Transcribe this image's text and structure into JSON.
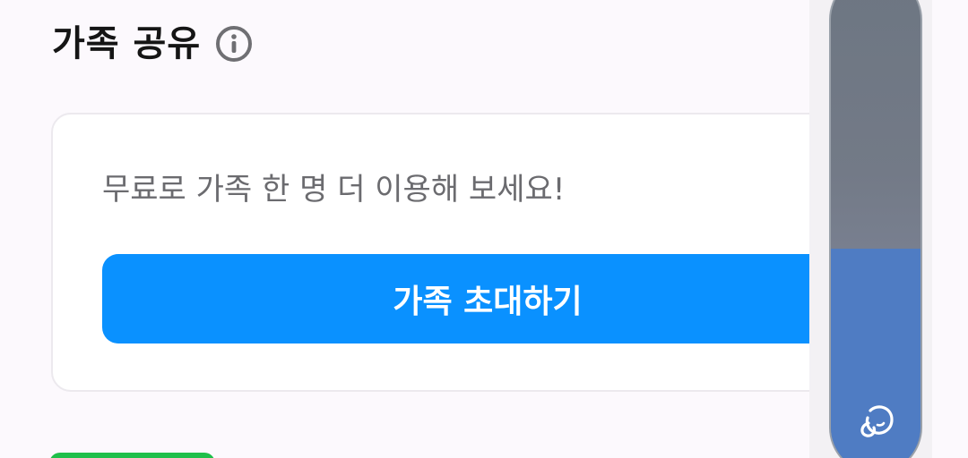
{
  "section": {
    "title": "가족 공유",
    "info_icon": "info-circle-icon"
  },
  "card": {
    "message": "무료로 가족 한 명 더 이용해 보세요!",
    "invite_button_label": "가족 초대하기"
  },
  "edge_handle": {
    "fill_fraction": 0.45,
    "icon": "assistant-bubble-icon"
  },
  "colors": {
    "accent": "#0a91ff",
    "title_text": "#151515",
    "message_text": "#6b6b6f",
    "handle_fill": "#4f7cc3",
    "green_badge": "#1fbf4a"
  }
}
